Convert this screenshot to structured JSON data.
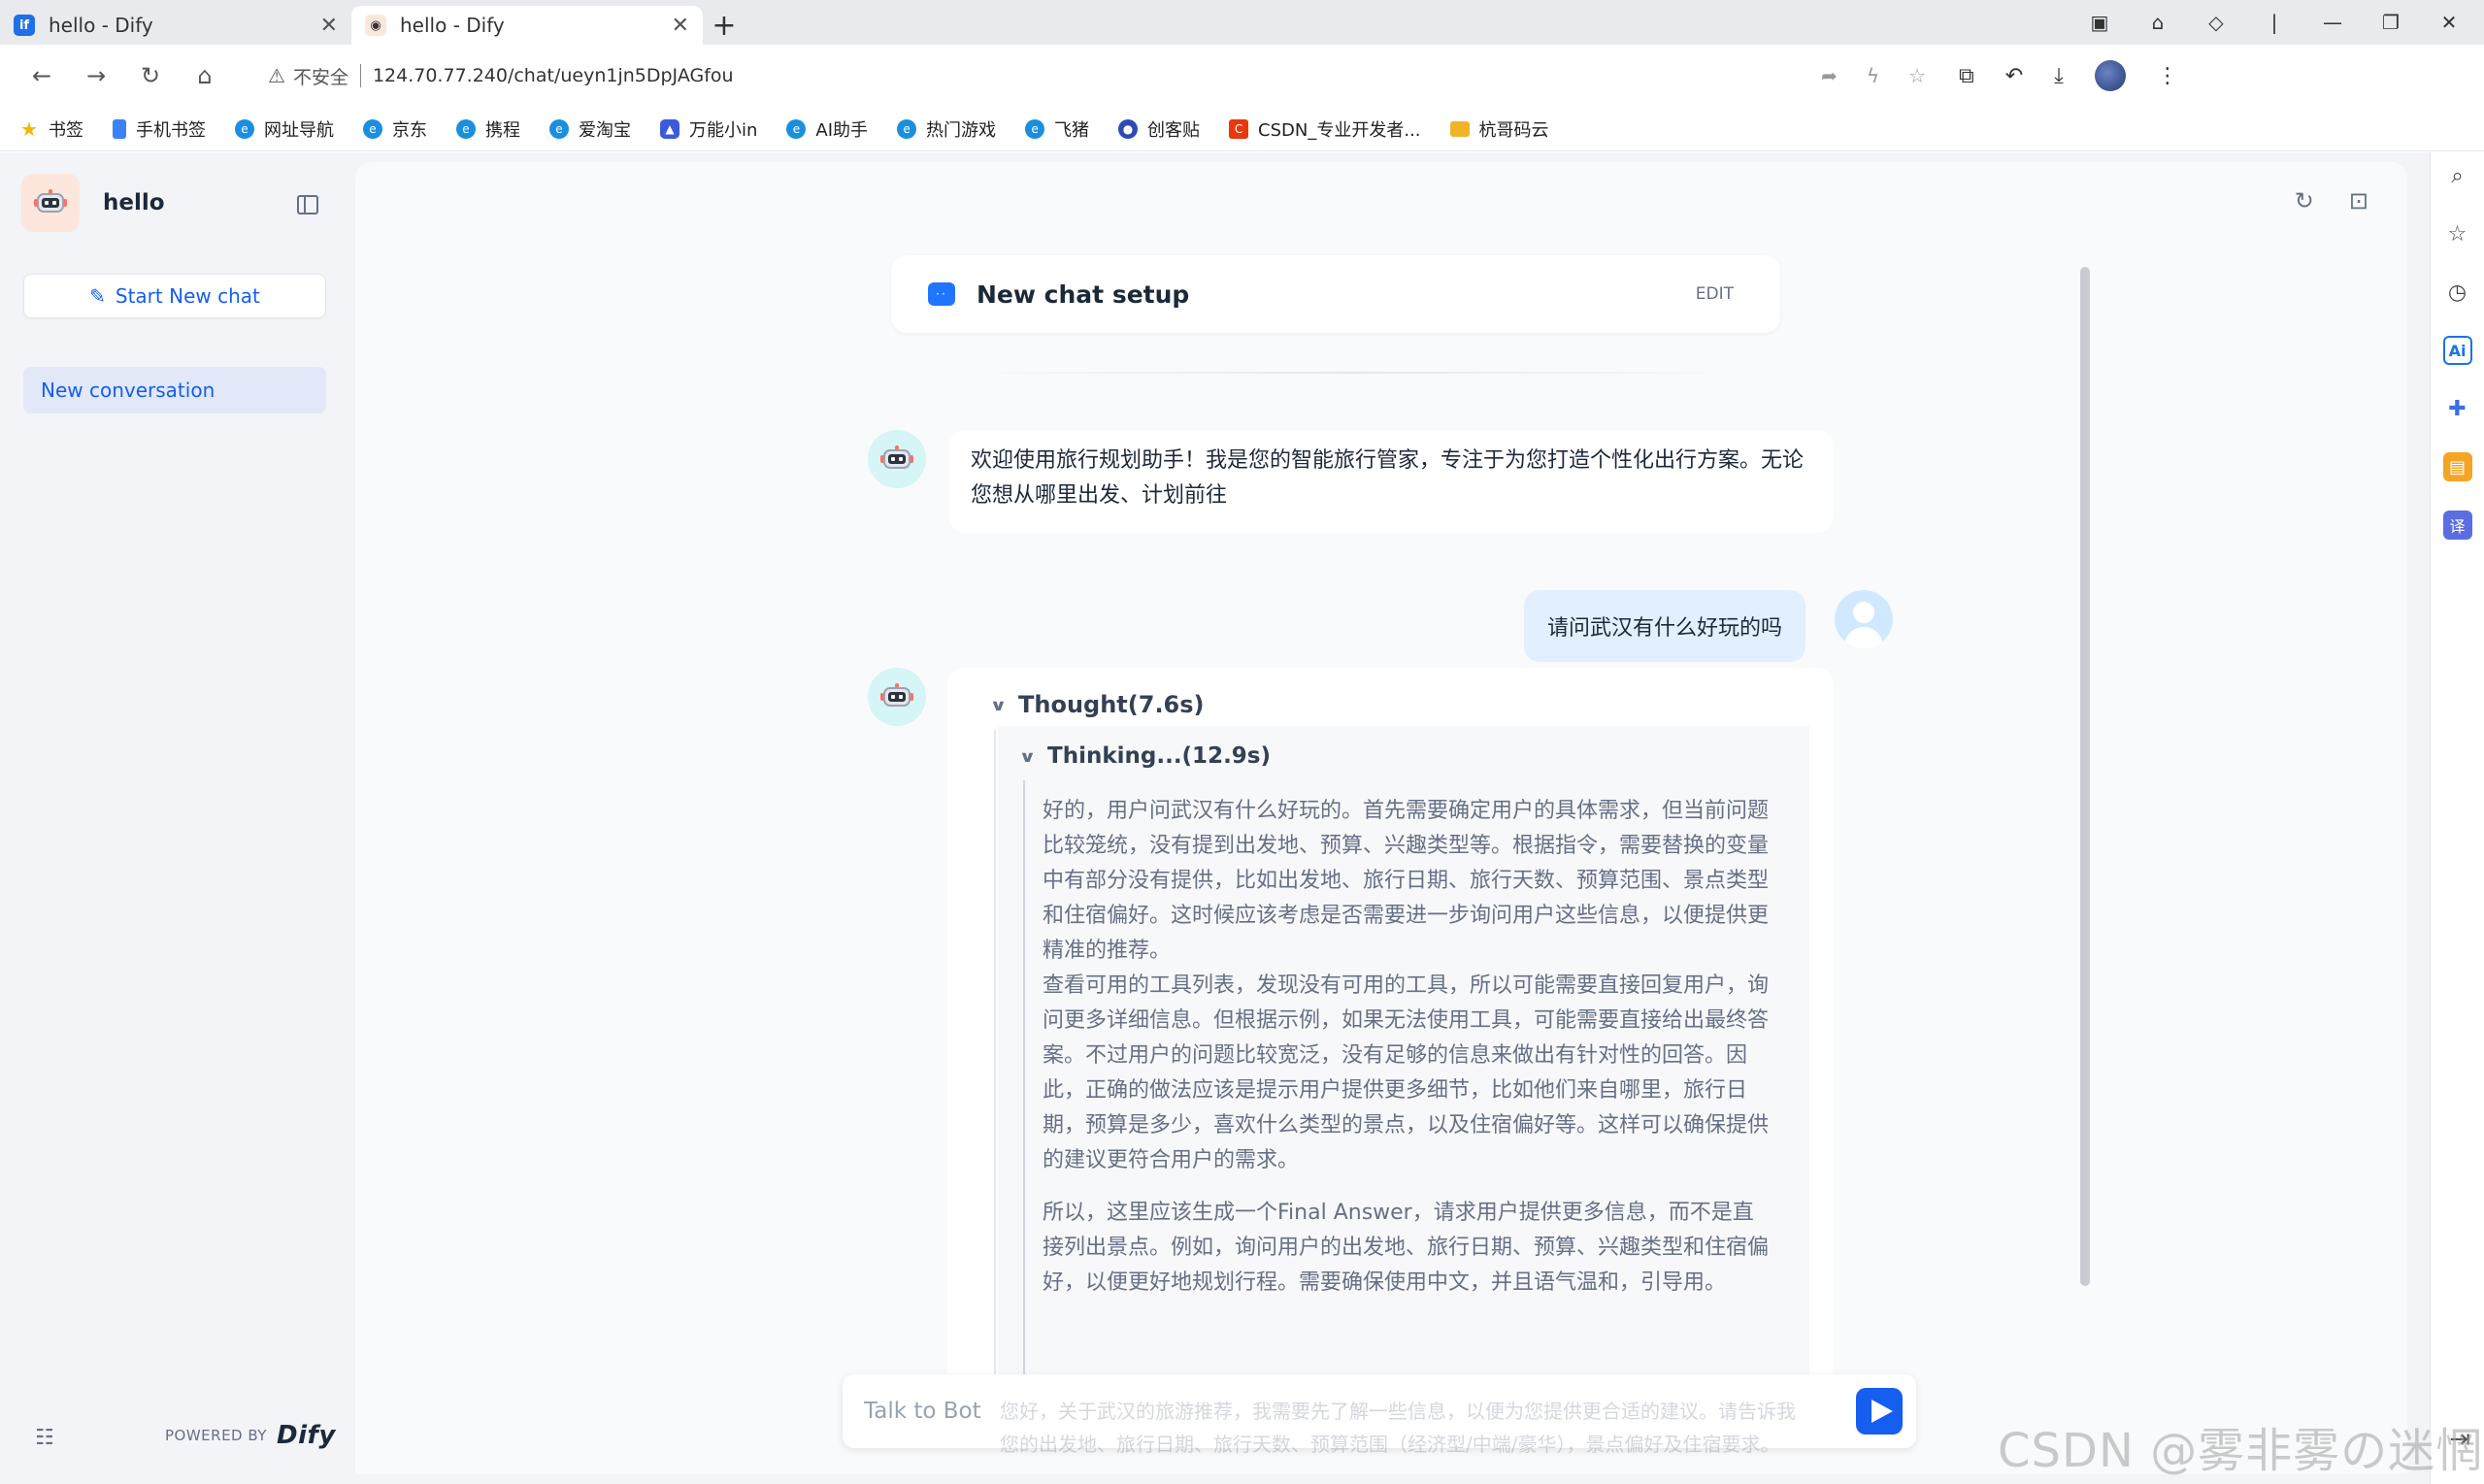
{
  "browser": {
    "tabs": [
      {
        "title": "hello - Dify",
        "favicon": "dify-favicon",
        "active": false
      },
      {
        "title": "hello - Dify",
        "favicon": "robot-favicon",
        "active": true
      }
    ],
    "address": {
      "security_label": "不安全",
      "url": "124.70.77.240/chat/ueyn1jn5DpJAGfou"
    },
    "bookmarks": [
      {
        "label": "书签",
        "icon": "star-icon",
        "color": "#f5b400"
      },
      {
        "label": "手机书签",
        "icon": "bookmark-icon",
        "color": "#3b82f6"
      },
      {
        "label": "网址导航",
        "icon": "e-icon",
        "color": "#1a8fe0"
      },
      {
        "label": "京东",
        "icon": "e-icon",
        "color": "#1a8fe0"
      },
      {
        "label": "携程",
        "icon": "e-icon",
        "color": "#1a8fe0"
      },
      {
        "label": "爱淘宝",
        "icon": "e-icon",
        "color": "#1a8fe0"
      },
      {
        "label": "万能小in",
        "icon": "app-icon",
        "color": "#3b5bdb"
      },
      {
        "label": "AI助手",
        "icon": "e-icon",
        "color": "#1a8fe0"
      },
      {
        "label": "热门游戏",
        "icon": "e-icon",
        "color": "#1a8fe0"
      },
      {
        "label": "飞猪",
        "icon": "e-icon",
        "color": "#1a8fe0"
      },
      {
        "label": "创客贴",
        "icon": "app-icon",
        "color": "#2f4ab5"
      },
      {
        "label": "CSDN_专业开发者...",
        "icon": "csdn-icon",
        "color": "#e8380d"
      },
      {
        "label": "杭哥码云",
        "icon": "folder-icon",
        "color": "#f0b429"
      }
    ]
  },
  "sidebar": {
    "app_name": "hello",
    "new_chat_label": "Start New chat",
    "conversations": [
      {
        "label": "New conversation",
        "active": true
      }
    ],
    "powered_by": "POWERED BY",
    "powered_brand": "Dify"
  },
  "chat": {
    "setup_title": "New chat setup",
    "setup_edit": "EDIT",
    "welcome_message": "欢迎使用旅行规划助手！我是您的智能旅行管家，专注于为您打造个性化出行方案。无论您想从哪里出发、计划前往",
    "user_message": "请问武汉有什么好玩的吗",
    "thought_label": "Thought(7.6s)",
    "thinking_label": "Thinking...(12.9s)",
    "thinking_paragraphs": [
      "好的，用户问武汉有什么好玩的。首先需要确定用户的具体需求，但当前问题比较笼统，没有提到出发地、预算、兴趣类型等。根据指令，需要替换的变量中有部分没有提供，比如出发地、旅行日期、旅行天数、预算范围、景点类型和住宿偏好。这时候应该考虑是否需要进一步询问用户这些信息，以便提供更精准的推荐。\n查看可用的工具列表，发现没有可用的工具，所以可能需要直接回复用户，询问更多详细信息。但根据示例，如果无法使用工具，可能需要直接给出最终答案。不过用户的问题比较宽泛，没有足够的信息来做出有针对性的回答。因此，正确的做法应该是提示用户提供更多细节，比如他们来自哪里，旅行日期，预算是多少，喜欢什么类型的景点，以及住宿偏好等。这样可以确保提供的建议更符合用户的需求。",
      "所以，这里应该生成一个Final Answer，请求用户提供更多信息，而不是直接列出景点。例如，询问用户的出发地、旅行日期、预算、兴趣类型和住宿偏好，以便更好地规划行程。需要确保使用中文，并且语气温和，引导用。"
    ],
    "faded_preview": "您好，关于武汉的旅游推荐，我需要先了解一些信息，以便为您提供更合适的建议。请告诉我您的出发地、旅行日期、旅行天数、预算范围（经济型/中端/豪华），景点偏好及住宿要求。",
    "input_placeholder": "Talk to Bot"
  },
  "watermark": "CSDN @雾非雾の迷惘"
}
